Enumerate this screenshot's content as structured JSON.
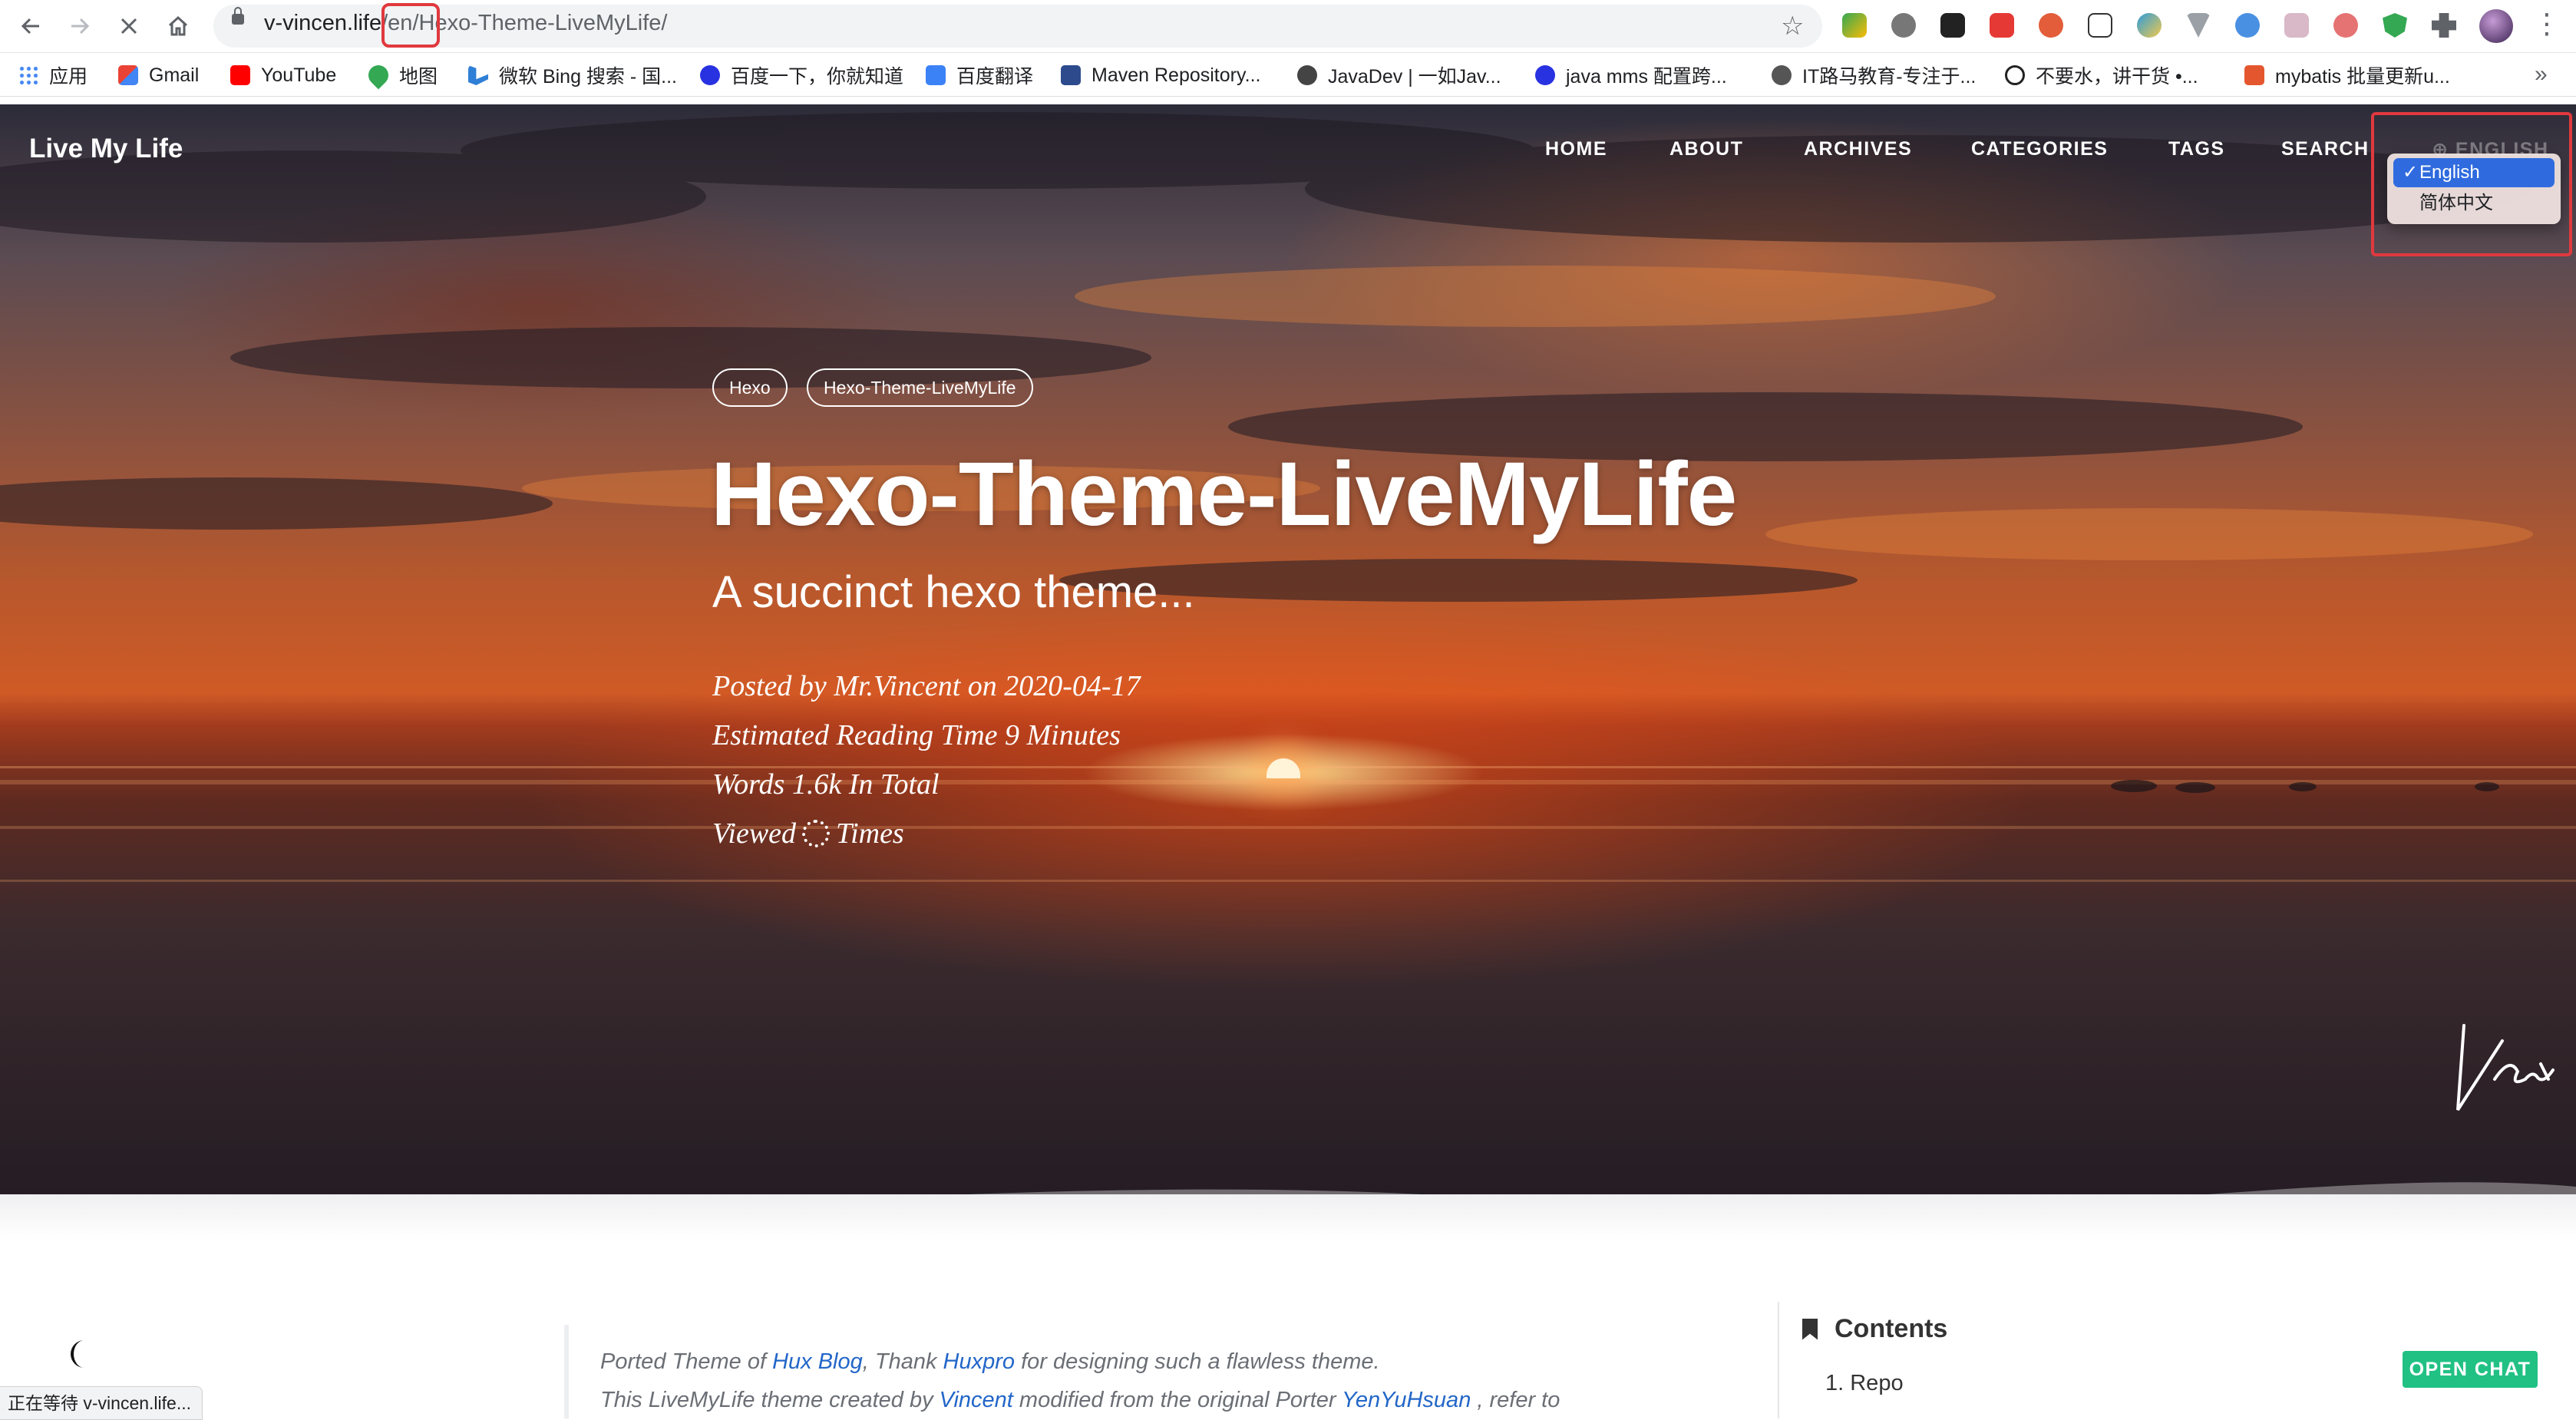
{
  "browser": {
    "url_host": "v-vincen.life",
    "url_path_lang": "/en/",
    "url_path_rest": "Hexo-Theme-LiveMyLife/",
    "nav": {
      "back": "back-arrow",
      "forward": "forward-arrow",
      "stop": "stop-loading",
      "home": "home"
    }
  },
  "bookmarks": [
    {
      "label": "应用",
      "icon": "apps-grid-icon",
      "color": "#4285f4"
    },
    {
      "label": "Gmail",
      "icon": "gmail-icon",
      "color": "#ea4335"
    },
    {
      "label": "YouTube",
      "icon": "youtube-icon",
      "color": "#ff0000"
    },
    {
      "label": "地图",
      "icon": "maps-pin-icon",
      "color": "#34a853"
    },
    {
      "label": "微软 Bing 搜索 - 国...",
      "icon": "bing-icon",
      "color": "#2f7fd6"
    },
    {
      "label": "百度一下，你就知道",
      "icon": "baidu-paw-icon",
      "color": "#2932e1"
    },
    {
      "label": "百度翻译",
      "icon": "baidu-translate-icon",
      "color": "#3b82f6"
    },
    {
      "label": "Maven Repository...",
      "icon": "maven-icon",
      "color": "#2d4b8c"
    },
    {
      "label": "JavaDev | 一如Jav...",
      "icon": "javadev-icon",
      "color": "#444444"
    },
    {
      "label": "java mms 配置跨...",
      "icon": "baidu-paw-icon",
      "color": "#2932e1"
    },
    {
      "label": "IT路马教育-专注于...",
      "icon": "globe-icon",
      "color": "#555555"
    },
    {
      "label": "不要水，讲干货 •...",
      "icon": "github-icon",
      "color": "#222222"
    },
    {
      "label": "mybatis 批量更新u...",
      "icon": "csdn-icon",
      "color": "#e4572e"
    }
  ],
  "site": {
    "brand": "Live My Life",
    "nav": [
      "HOME",
      "ABOUT",
      "ARCHIVES",
      "CATEGORIES",
      "TAGS",
      "SEARCH"
    ],
    "lang_button": "⊕ ENGLISH",
    "lang_options": {
      "selected": "English",
      "check": "✓",
      "other": "简体中文"
    }
  },
  "post": {
    "tags": [
      "Hexo",
      "Hexo-Theme-LiveMyLife"
    ],
    "title": "Hexo-Theme-LiveMyLife",
    "subtitle": "A succinct hexo theme...",
    "posted": "Posted by Mr.Vincent on 2020-04-17",
    "reading": "Estimated Reading Time 9 Minutes",
    "words": "Words 1.6k In Total",
    "viewed_prefix": "Viewed",
    "viewed_suffix": "Times"
  },
  "content": {
    "line1": {
      "a": "Ported Theme of ",
      "b": "Hux Blog",
      "c": ", Thank ",
      "d": "Huxpro",
      "e": " for designing such a flawless theme."
    },
    "line2": {
      "a": "This LiveMyLife theme created by ",
      "b": "Vincent",
      "c": " modified from the original Porter ",
      "d": "YenYuHsuan",
      "e": " , refer to"
    }
  },
  "toc": {
    "heading": "Contents",
    "items": [
      "1. Repo"
    ]
  },
  "status_text": "正在等待 v-vincen.life...",
  "chat_label": "OPEN CHAT",
  "colors": {
    "accent_red": "#e0393e",
    "select_blue": "#2f6bde",
    "chat_green": "#21c184",
    "link_blue": "#2266c8"
  }
}
